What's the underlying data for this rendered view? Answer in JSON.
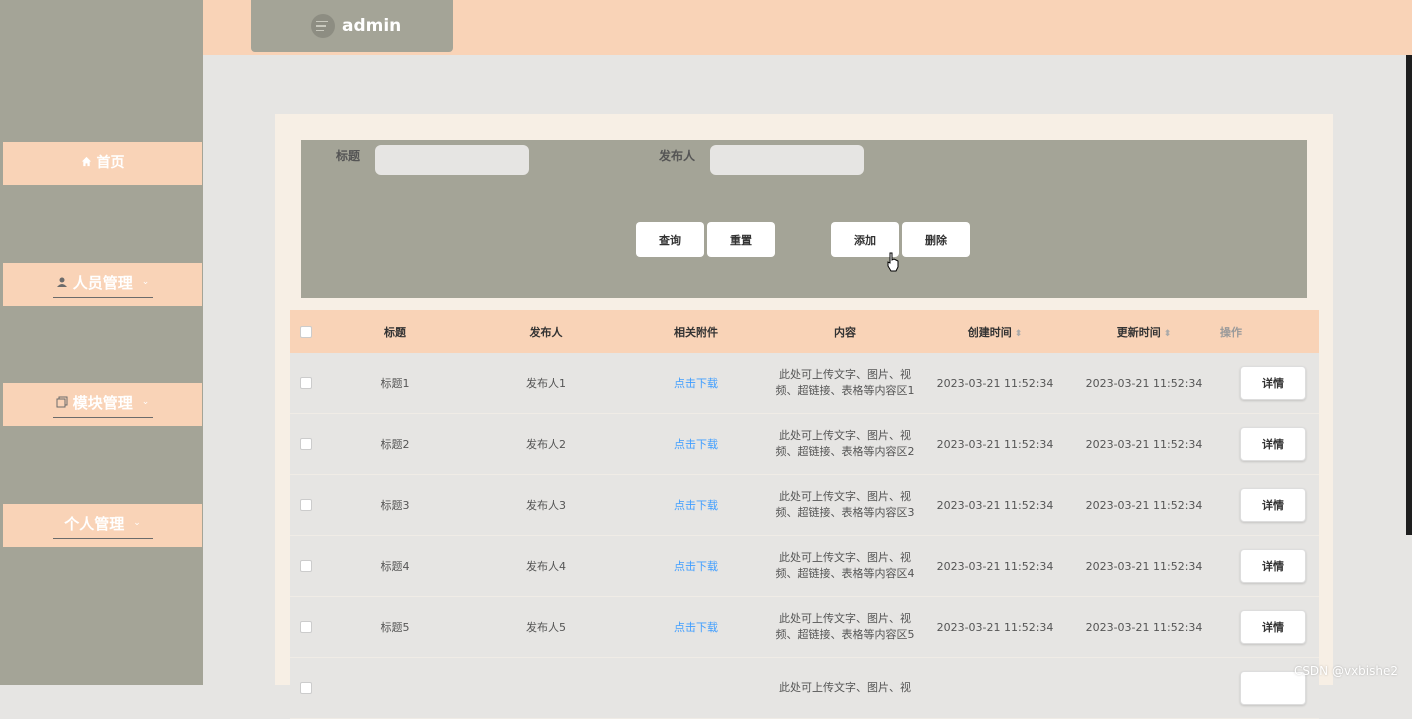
{
  "brand": {
    "name": "admin",
    "icon": "menu-lines-icon"
  },
  "sidebar": {
    "items": [
      {
        "label": "首页",
        "icon": "home-icon"
      },
      {
        "label": "人员管理",
        "icon": "user-icon"
      },
      {
        "label": "模块管理",
        "icon": "copy-icon"
      },
      {
        "label": "个人管理",
        "icon": ""
      }
    ]
  },
  "search": {
    "title_label": "标题",
    "publisher_label": "发布人",
    "buttons": {
      "query": "查询",
      "reset": "重置",
      "add": "添加",
      "delete": "删除"
    }
  },
  "table": {
    "headers": [
      "标题",
      "发布人",
      "相关附件",
      "内容",
      "创建时间",
      "更新时间",
      "操作"
    ],
    "rows": [
      {
        "title": "标题1",
        "publisher": "发布人1",
        "attachment": "点击下载",
        "content_line1": "此处可上传文字、图片、视",
        "content_line2": "频、超链接、表格等内容区1",
        "created": "2023-03-21 11:52:34",
        "updated": "2023-03-21 11:52:34",
        "action": "详情"
      },
      {
        "title": "标题2",
        "publisher": "发布人2",
        "attachment": "点击下载",
        "content_line1": "此处可上传文字、图片、视",
        "content_line2": "频、超链接、表格等内容区2",
        "created": "2023-03-21 11:52:34",
        "updated": "2023-03-21 11:52:34",
        "action": "详情"
      },
      {
        "title": "标题3",
        "publisher": "发布人3",
        "attachment": "点击下载",
        "content_line1": "此处可上传文字、图片、视",
        "content_line2": "频、超链接、表格等内容区3",
        "created": "2023-03-21 11:52:34",
        "updated": "2023-03-21 11:52:34",
        "action": "详情"
      },
      {
        "title": "标题4",
        "publisher": "发布人4",
        "attachment": "点击下载",
        "content_line1": "此处可上传文字、图片、视",
        "content_line2": "频、超链接、表格等内容区4",
        "created": "2023-03-21 11:52:34",
        "updated": "2023-03-21 11:52:34",
        "action": "详情"
      },
      {
        "title": "标题5",
        "publisher": "发布人5",
        "attachment": "点击下载",
        "content_line1": "此处可上传文字、图片、视",
        "content_line2": "频、超链接、表格等内容区5",
        "created": "2023-03-21 11:52:34",
        "updated": "2023-03-21 11:52:34",
        "action": "详情"
      },
      {
        "title": "",
        "publisher": "",
        "attachment": "",
        "content_line1": "此处可上传文字、图片、视",
        "content_line2": "",
        "created": "",
        "updated": "",
        "action": ""
      }
    ]
  },
  "watermark": "CSDN @vxbishe2",
  "colors": {
    "accent": "#f9d3b7",
    "sidebar": "#a4a497",
    "link": "#409eff"
  }
}
